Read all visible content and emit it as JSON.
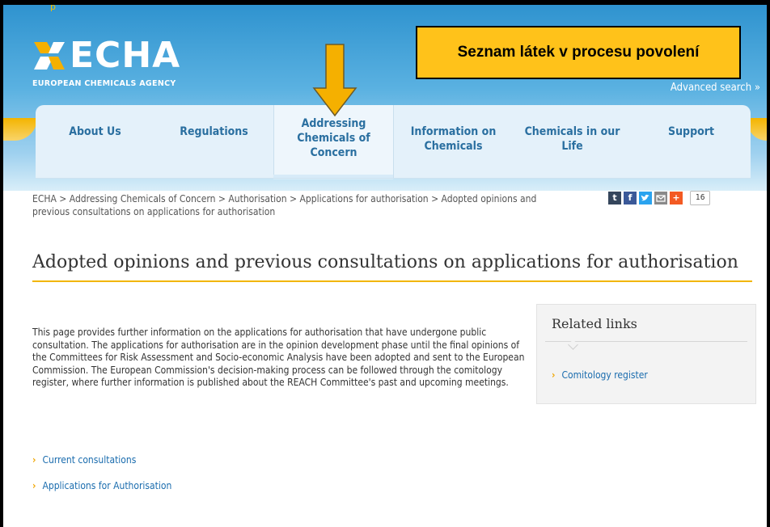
{
  "top_strip": {
    "text": "p"
  },
  "header": {
    "logo_text": "ECHA",
    "logo_subtitle": "EUROPEAN CHEMICALS AGENCY",
    "callout": "Seznam látek v procesu povolení",
    "advanced_search": "Advanced search »",
    "arrow_color": "#f5b000",
    "background_color": "#3b9bd6"
  },
  "nav": {
    "items": [
      {
        "label": "About Us"
      },
      {
        "label": "Regulations"
      },
      {
        "label": "Addressing Chemicals of Concern",
        "active": true
      },
      {
        "label": "Information on Chemicals"
      },
      {
        "label": "Chemicals in our Life"
      },
      {
        "label": "Support"
      }
    ]
  },
  "breadcrumb": {
    "text": "ECHA > Addressing Chemicals of Concern > Authorisation > Applications for authorisation > Adopted opinions and previous consultations on applications for authorisation"
  },
  "share": {
    "icons": [
      "tumblr-icon",
      "facebook-icon",
      "twitter-icon",
      "email-icon",
      "google-plus-icon"
    ],
    "count": "16"
  },
  "main": {
    "title": "Adopted opinions and previous consultations on applications for authorisation",
    "intro": "This page provides further information on the applications for authorisation that have undergone public consultation. The applications for authorisation are in the opinion development phase until the final opinions of the Committees for Risk Assessment and Socio-economic Analysis have been adopted and sent to the European Commission. The European Commission's decision-making process can be followed through the comitology register, where further information is published about the REACH Committee's past and upcoming meetings.",
    "links": [
      {
        "label": "Current consultations"
      },
      {
        "label": "Applications for Authorisation"
      }
    ]
  },
  "related": {
    "title": "Related links",
    "links": [
      {
        "label": "Comitology register"
      }
    ]
  },
  "colors": {
    "accent": "#f2b600",
    "link": "#1a6cae",
    "nav_text": "#2a6fa0"
  }
}
